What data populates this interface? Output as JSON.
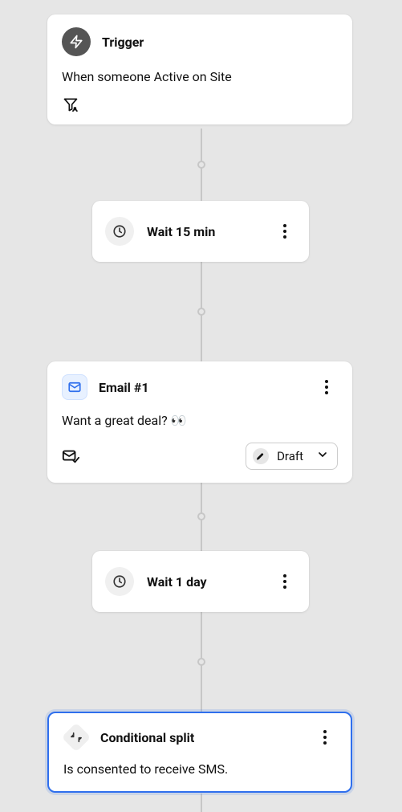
{
  "colors": {
    "accent": "#2f6fed",
    "line": "#c7c7c7",
    "card_bg": "#ffffff",
    "bg": "#e6e6e6"
  },
  "nodes": {
    "trigger": {
      "title": "Trigger",
      "description": "When someone Active on Site",
      "footer_icon": "filter-profile-icon"
    },
    "wait1": {
      "label": "Wait 15 min"
    },
    "email1": {
      "title": "Email #1",
      "subject": "Want a great deal? 👀",
      "footer_icon": "email-check-icon",
      "status": {
        "label": "Draft",
        "icon": "pencil-circle-icon"
      }
    },
    "wait2": {
      "label": "Wait 1 day"
    },
    "split": {
      "title": "Conditional split",
      "description": "Is consented to receive SMS."
    }
  }
}
